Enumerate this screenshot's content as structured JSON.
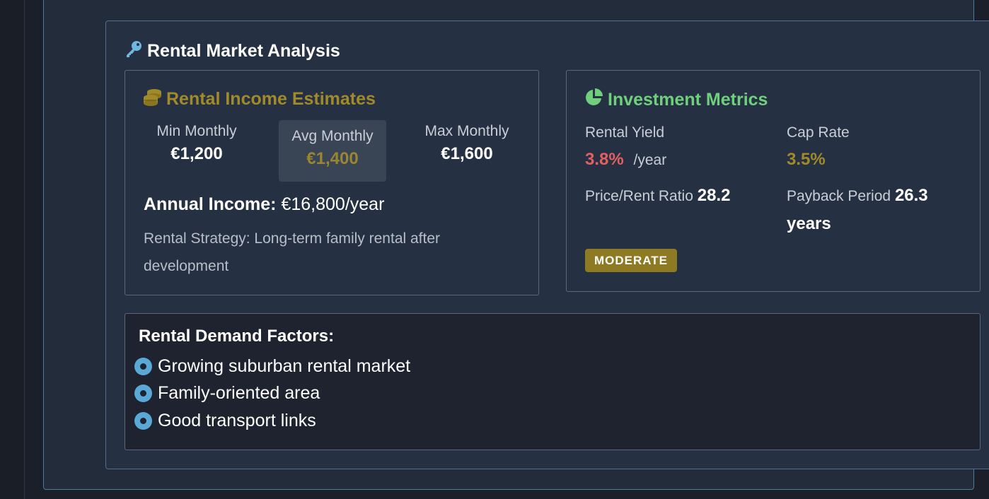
{
  "section": {
    "title": "Rental Market Analysis",
    "icon": "key-icon"
  },
  "income": {
    "title": "Rental Income Estimates",
    "icon": "coins-icon",
    "min_label": "Min Monthly",
    "min_value": "€1,200",
    "avg_label": "Avg Monthly",
    "avg_value": "€1,400",
    "max_label": "Max Monthly",
    "max_value": "€1,600",
    "annual_label": "Annual Income:",
    "annual_value": "€16,800/year",
    "strategy": "Rental Strategy: Long-term family rental after development"
  },
  "metrics": {
    "title": "Investment Metrics",
    "icon": "pie-chart-icon",
    "yield_label": "Rental Yield",
    "yield_value": "3.8%",
    "yield_unit": "/year",
    "cap_label": "Cap Rate",
    "cap_value": "3.5%",
    "ratio_label": "Price/Rent Ratio",
    "ratio_value": "28.2",
    "payback_label": "Payback Period",
    "payback_value": "26.3 years",
    "badge": "MODERATE"
  },
  "demand": {
    "title": "Rental Demand Factors:",
    "items": [
      "Growing suburban rental market",
      "Family-oriented area",
      "Good transport links"
    ]
  },
  "colors": {
    "gold": "#a08a2a",
    "green": "#6fcf7c",
    "red": "#e45f5f",
    "accent_blue": "#5aa8d6",
    "badge_bg": "#8e7a22"
  }
}
